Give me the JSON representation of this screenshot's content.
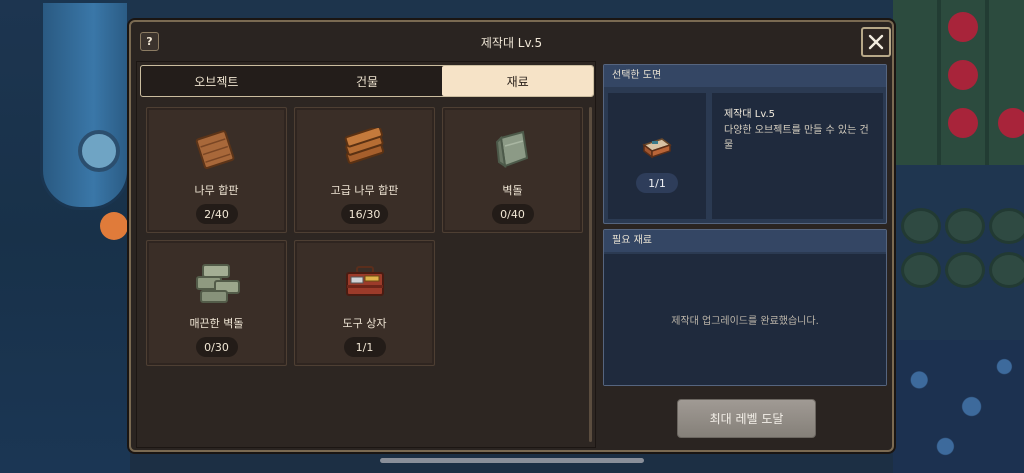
{
  "window": {
    "title": "제작대 Lv.5",
    "help_label": "?"
  },
  "tabs": [
    {
      "label": "오브젝트",
      "active": false
    },
    {
      "label": "건물",
      "active": false
    },
    {
      "label": "재료",
      "active": true
    }
  ],
  "materials": [
    {
      "name": "나무 합판",
      "count": "2/40",
      "icon": "wood-plank-icon"
    },
    {
      "name": "고급 나무 합판",
      "count": "16/30",
      "icon": "premium-wood-plank-icon"
    },
    {
      "name": "벽돌",
      "count": "0/40",
      "icon": "brick-icon"
    },
    {
      "name": "매끈한 벽돌",
      "count": "0/30",
      "icon": "smooth-brick-icon"
    },
    {
      "name": "도구 상자",
      "count": "1/1",
      "icon": "toolbox-icon"
    }
  ],
  "blueprint": {
    "header": "선택한 도면",
    "name": "제작대 Lv.5",
    "description": "다양한 오브젝트를 만들 수 있는 건물",
    "count": "1/1",
    "icon": "workbench-icon"
  },
  "requirements": {
    "header": "필요 재료",
    "message": "제작대 업그레이드를 완료했습니다."
  },
  "action_button": {
    "label": "최대 레벨 도달"
  },
  "colors": {
    "window_bg": "#2a2421",
    "tab_active": "#f6e3c7",
    "panel_blue": "#2b3a52",
    "button_gray": "#a09a94"
  }
}
